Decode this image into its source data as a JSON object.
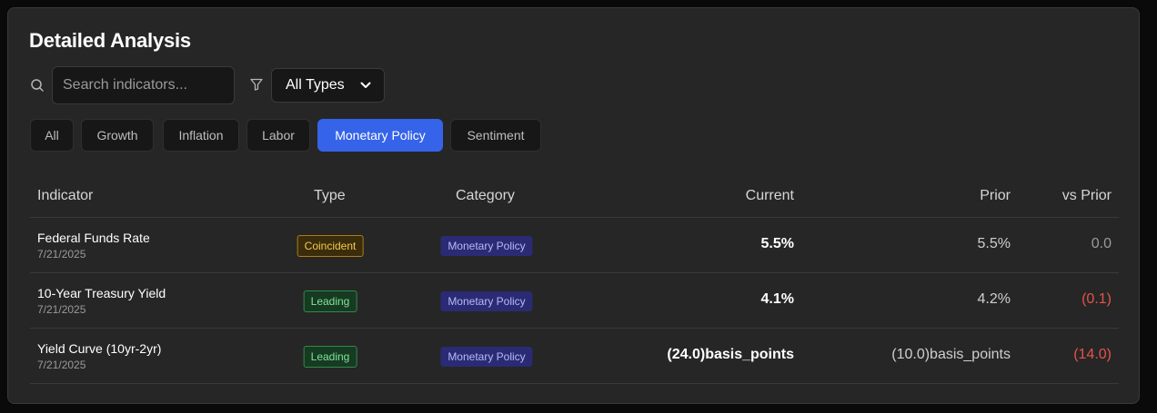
{
  "title": "Detailed Analysis",
  "search": {
    "placeholder": "Search indicators..."
  },
  "type_filter": {
    "selected": "All Types"
  },
  "tabs": [
    {
      "label": "All",
      "active": false
    },
    {
      "label": "Growth",
      "active": false
    },
    {
      "label": "Inflation",
      "active": false
    },
    {
      "label": "Labor",
      "active": false
    },
    {
      "label": "Monetary Policy",
      "active": true
    },
    {
      "label": "Sentiment",
      "active": false
    }
  ],
  "table": {
    "headers": {
      "indicator": "Indicator",
      "type": "Type",
      "category": "Category",
      "current": "Current",
      "prior": "Prior",
      "vs_prior": "vs Prior"
    },
    "rows": [
      {
        "name": "Federal Funds Rate",
        "date": "7/21/2025",
        "type": "Coincident",
        "category": "Monetary Policy",
        "current": "5.5%",
        "prior": "5.5%",
        "vs_prior": "0.0",
        "vs_prior_color": "#9a9a9a"
      },
      {
        "name": "10-Year Treasury Yield",
        "date": "7/21/2025",
        "type": "Leading",
        "category": "Monetary Policy",
        "current": "4.1%",
        "prior": "4.2%",
        "vs_prior": "(0.1)",
        "vs_prior_color": "#e5534b"
      },
      {
        "name": "Yield Curve (10yr-2yr)",
        "date": "7/21/2025",
        "type": "Leading",
        "category": "Monetary Policy",
        "current": "(24.0)basis_points",
        "prior": "(10.0)basis_points",
        "vs_prior": "(14.0)",
        "vs_prior_color": "#e5534b"
      }
    ]
  },
  "colors": {
    "accent": "#3563e9",
    "negative": "#e5534b",
    "neutral": "#9a9a9a"
  },
  "icons": {
    "search": "search-icon",
    "filter": "filter-icon",
    "dropdown": "chevron-down-icon"
  }
}
